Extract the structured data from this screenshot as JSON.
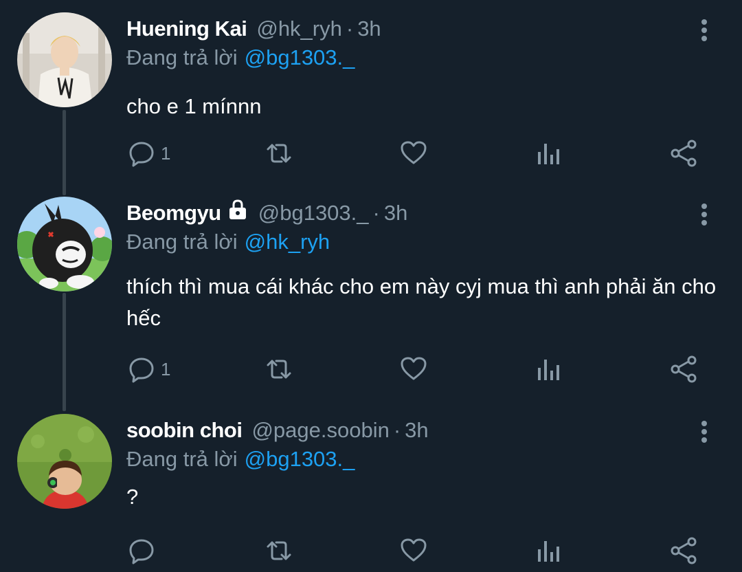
{
  "tweets": [
    {
      "name": "Huening Kai",
      "handle": "@hk_ryh",
      "dot": "·",
      "time": "3h",
      "reply_prefix": "Đang trả lời",
      "reply_mention": "@bg1303._",
      "text": "cho e 1 mínnn",
      "reply_count": "1",
      "locked": false
    },
    {
      "name": "Beomgyu",
      "handle": "@bg1303._",
      "dot": "·",
      "time": "3h",
      "reply_prefix": "Đang trả lời",
      "reply_mention": "@hk_ryh",
      "text": "thích thì mua cái khác cho em này cyj mua thì anh phải ăn cho hếc",
      "reply_count": "1",
      "locked": true
    },
    {
      "name": "soobin choi",
      "handle": "@page.soobin",
      "dot": "·",
      "time": "3h",
      "reply_prefix": "Đang trả lời",
      "reply_mention": "@bg1303._",
      "text": "?",
      "reply_count": "",
      "locked": false
    }
  ],
  "icons": {
    "reply": "reply-icon",
    "retweet": "retweet-icon",
    "like": "heart-icon",
    "analytics": "analytics-icon",
    "share": "share-icon",
    "more": "more-vertical-icon",
    "lock": "lock-icon"
  },
  "colors": {
    "background": "#15202b",
    "name": "#ffffff",
    "muted": "#8899a6",
    "mention": "#1da1f2",
    "connector": "#38444d"
  }
}
